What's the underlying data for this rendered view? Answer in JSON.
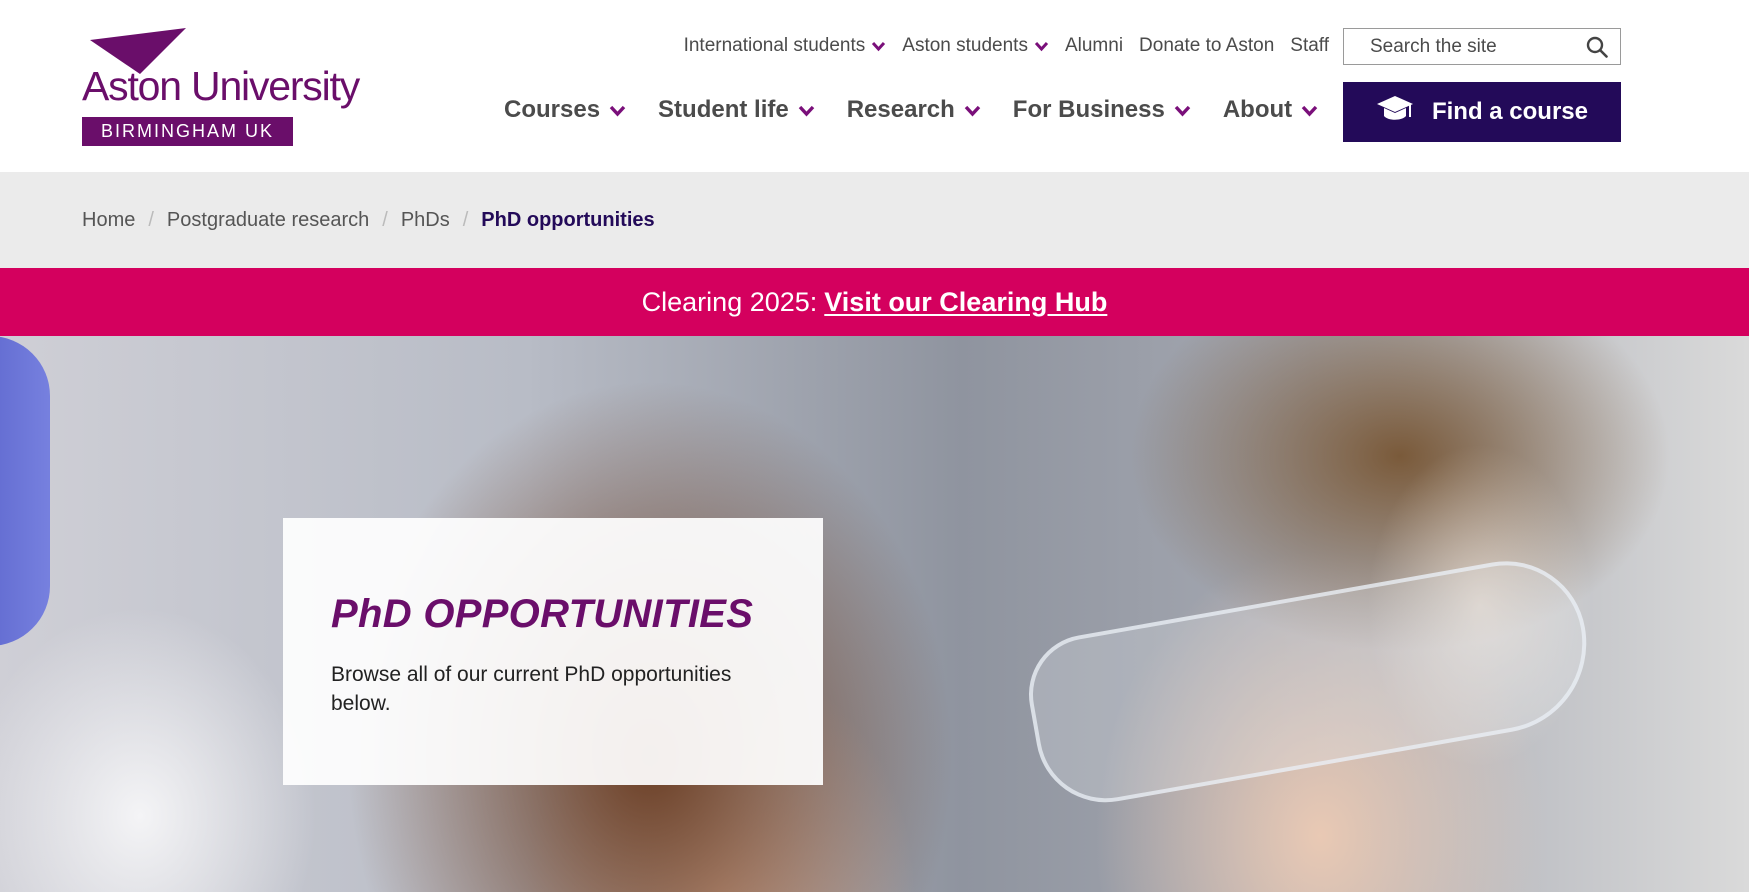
{
  "brand": {
    "name": "Aston University",
    "location": "BIRMINGHAM UK",
    "color": "#6a0e6a"
  },
  "utility_nav": [
    {
      "label": "International students",
      "has_dropdown": true
    },
    {
      "label": "Aston students",
      "has_dropdown": true
    },
    {
      "label": "Alumni",
      "has_dropdown": false
    },
    {
      "label": "Donate to Aston",
      "has_dropdown": false
    },
    {
      "label": "Staff",
      "has_dropdown": false
    }
  ],
  "search": {
    "placeholder": "Search the site",
    "icon": "search-icon"
  },
  "main_nav": [
    {
      "label": "Courses"
    },
    {
      "label": "Student life"
    },
    {
      "label": "Research"
    },
    {
      "label": "For Business"
    },
    {
      "label": "About"
    }
  ],
  "cta": {
    "label": "Find a course",
    "icon": "graduation-cap-icon",
    "color": "#230a59"
  },
  "breadcrumb": [
    {
      "label": "Home"
    },
    {
      "label": "Postgraduate research"
    },
    {
      "label": "PhDs"
    },
    {
      "label": "PhD opportunities",
      "current": true
    }
  ],
  "banner": {
    "prefix": "Clearing 2025:",
    "link_label": "Visit our Clearing Hub",
    "color": "#d4005e"
  },
  "hero": {
    "title": "PhD OPPORTUNITIES",
    "description": "Browse all of our current PhD opportunities below."
  }
}
